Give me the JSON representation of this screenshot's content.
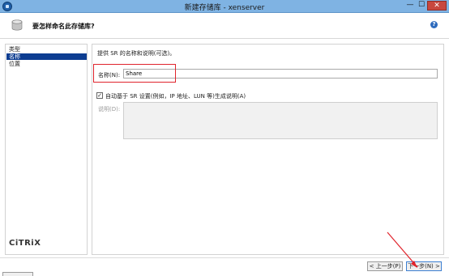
{
  "window": {
    "title": "新建存储库 - xenserver",
    "minimize": "—",
    "maximize": "☐",
    "close": "✕"
  },
  "header": {
    "title": "要怎样命名此存储库?",
    "help_icon": "?"
  },
  "sidebar": {
    "items": [
      {
        "label": "类型",
        "active": false
      },
      {
        "label": "名称",
        "active": true
      },
      {
        "label": "位置",
        "active": false
      }
    ],
    "logo_text": "CiTRiX"
  },
  "main": {
    "description": "提供 SR 的名称和说明(可选)。",
    "name_label": "名称(N):",
    "name_value": "Share",
    "auto_desc_checked": true,
    "auto_desc_label": "自动基于 SR 设置(例如，IP 地址、LUN 等)生成说明(A)",
    "desc_label": "说明(D):"
  },
  "footer": {
    "prev_button": "< 上一步(P)",
    "next_button": "下一步(N) >"
  },
  "colors": {
    "titlebar": "#7fb3e3",
    "active_item": "#0d3d91",
    "highlight_red": "#e0242c"
  },
  "icons": {
    "app": "xencenter-icon",
    "header": "storage-disk-icon",
    "help": "help-icon",
    "check": "checkmark-icon"
  }
}
